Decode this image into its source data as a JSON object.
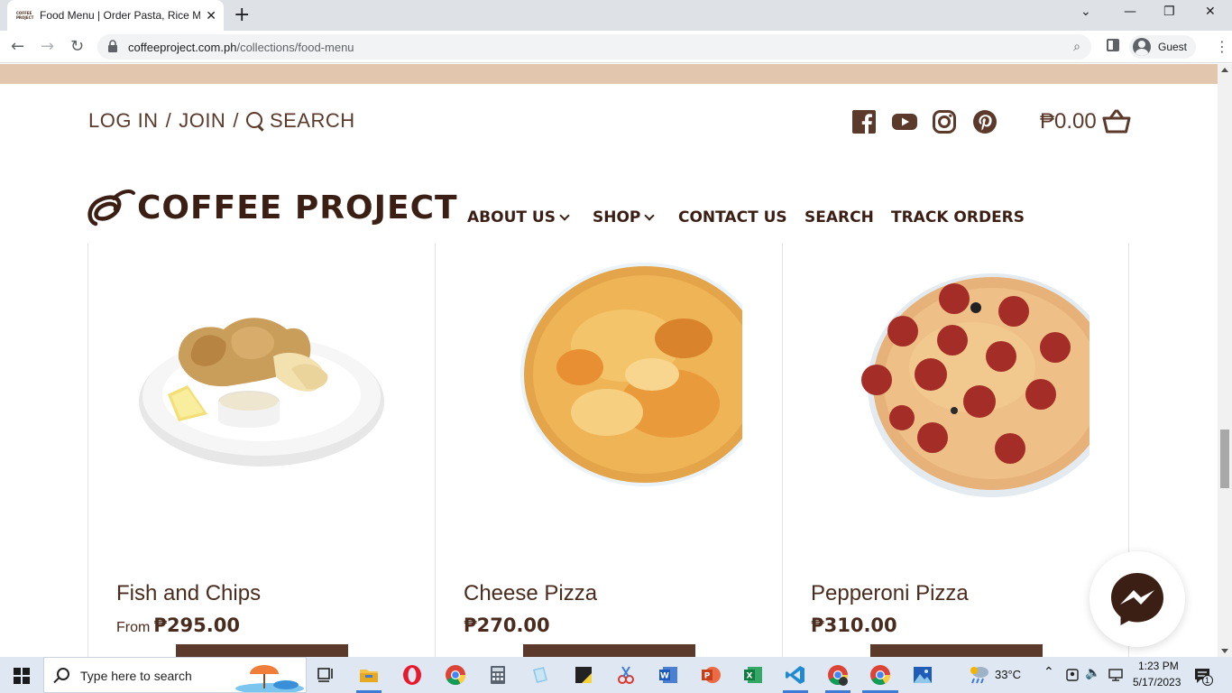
{
  "browser": {
    "tab_title": "Food Menu | Order Pasta, Rice M",
    "favicon_text": "COFFEE PROJECT",
    "url_host": "coffeeproject.com.ph",
    "url_path": "/collections/food-menu",
    "profile_label": "Guest"
  },
  "header": {
    "login": "LOG IN",
    "sep1": "/",
    "join": "JOIN",
    "sep2": "/",
    "search": "SEARCH",
    "cart_amount": "₱0.00",
    "logo_text": "COFFEE PROJECT",
    "social": [
      "facebook-icon",
      "youtube-icon",
      "instagram-icon",
      "pinterest-icon"
    ]
  },
  "mainnav": {
    "about": "ABOUT US",
    "shop": "SHOP",
    "contact": "CONTACT US",
    "search": "SEARCH",
    "track": "TRACK ORDERS"
  },
  "products": [
    {
      "title": "Fish and Chips",
      "price_prefix": "From",
      "price": "₱295.00"
    },
    {
      "title": "Cheese Pizza",
      "price_prefix": "",
      "price": "₱270.00"
    },
    {
      "title": "Pepperoni Pizza",
      "price_prefix": "",
      "price": "₱310.00"
    }
  ],
  "taskbar": {
    "search_placeholder": "Type here to search",
    "temperature": "33°C",
    "time": "1:23 PM",
    "date": "5/17/2023",
    "notifications": "1"
  },
  "colors": {
    "brand_brown": "#5b3a2b",
    "announce_bar": "#e3c6ae",
    "logo_dark": "#3b1f14"
  }
}
